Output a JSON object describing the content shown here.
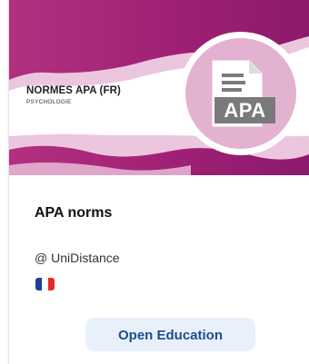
{
  "banner": {
    "title": "NORMES APA (FR)",
    "subtitle": "PSYCHOLOGIE",
    "doc_label": "APA",
    "icon": "document-icon"
  },
  "course": {
    "title": "APA norms",
    "provider": "@ UniDistance",
    "language_flag": "france-flag-icon"
  },
  "action": {
    "label": "Open Education"
  },
  "colors": {
    "banner_magenta": "#a8237a",
    "banner_pink": "#ecc6de",
    "circle_pink": "#e4b2d1",
    "button_bg": "#e8f1fb",
    "button_text": "#1f4b8f",
    "flag_blue": "#1f3f9e",
    "flag_white": "#ffffff",
    "flag_red": "#e32b2b"
  }
}
